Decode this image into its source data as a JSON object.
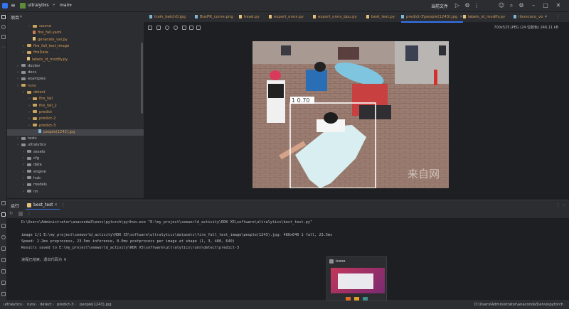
{
  "titlebar": {
    "project": "ultralytics",
    "branch": "main",
    "current_file": "当前文件",
    "menu_icon": "hamburger-icon"
  },
  "project_panel": {
    "title": "项目",
    "items": [
      {
        "label": "source",
        "type": "folder",
        "depth": 3,
        "color": "orange"
      },
      {
        "label": "fire_fall.yaml",
        "type": "yaml",
        "depth": 3
      },
      {
        "label": "generate_val.py",
        "type": "py",
        "depth": 3
      },
      {
        "label": "fire_fall_test_image",
        "type": "folder",
        "depth": 2,
        "color": "orange"
      },
      {
        "label": "fireData",
        "type": "folder",
        "depth": 2,
        "color": "orange"
      },
      {
        "label": "labels_id_modify.py",
        "type": "py",
        "depth": 2
      },
      {
        "label": "docker",
        "type": "folder",
        "depth": 1
      },
      {
        "label": "docs",
        "type": "folder",
        "depth": 1
      },
      {
        "label": "examples",
        "type": "folder",
        "depth": 1
      },
      {
        "label": "runs",
        "type": "folder",
        "depth": 1,
        "color": "orange"
      },
      {
        "label": "detect",
        "type": "folder",
        "depth": 2,
        "color": "orange"
      },
      {
        "label": "fire_fall",
        "type": "folder",
        "depth": 3,
        "color": "orange"
      },
      {
        "label": "fire_fall_2",
        "type": "folder",
        "depth": 3,
        "color": "orange"
      },
      {
        "label": "predict",
        "type": "folder",
        "depth": 3,
        "color": "orange"
      },
      {
        "label": "predict-2",
        "type": "folder",
        "depth": 3,
        "color": "orange"
      },
      {
        "label": "predict-3",
        "type": "folder",
        "depth": 3,
        "color": "orange"
      },
      {
        "label": "people(1243).jpg",
        "type": "img",
        "depth": 4,
        "selected": true
      },
      {
        "label": "tests",
        "type": "folder",
        "depth": 1
      },
      {
        "label": "ultralytics",
        "type": "folder",
        "depth": 1
      },
      {
        "label": "assets",
        "type": "folder",
        "depth": 2
      },
      {
        "label": "cfg",
        "type": "folder",
        "depth": 2
      },
      {
        "label": "data",
        "type": "folder",
        "depth": 2
      },
      {
        "label": "engine",
        "type": "folder",
        "depth": 2
      },
      {
        "label": "hub",
        "type": "folder",
        "depth": 2
      },
      {
        "label": "models",
        "type": "folder",
        "depth": 2
      },
      {
        "label": "nn",
        "type": "folder",
        "depth": 2
      }
    ]
  },
  "tabs": [
    {
      "label": "train_batch0.jpg"
    },
    {
      "label": "BoxPR_curve.png"
    },
    {
      "label": "head.py"
    },
    {
      "label": "export_onnx.py"
    },
    {
      "label": "export_onnx_bpu.py"
    },
    {
      "label": "best_test.py"
    },
    {
      "label": "predict-3\\people(1243).jpg",
      "active": true
    },
    {
      "label": "labels_id_modify.py"
    },
    {
      "label": "ilovecoco_vo"
    }
  ],
  "image_info": "700x525 JPEG (24 位颜色) 246.11 kB",
  "image": {
    "detection_label": "1 0.70",
    "watermark": "来自网"
  },
  "run_panel": {
    "title": "运行",
    "tab_label": "best_test",
    "lines": [
      "D:\\Users\\Administrator\\anaconda3\\envs\\pytorch\\python.exe \"E:\\my_project\\seeworld_activity\\RDK X5\\software\\ultralytics\\best_test.py\"",
      "",
      "image 1/1 E:\\my_project\\seeworld_activity\\RDK X5\\software\\ultralytics\\datasets\\fire_fall_test_image\\people(1243).jpg: 480x640 1 fall, 23.5ms",
      "Speed: 2.2ms preprocess, 23.5ms inference, 0.0ms postprocess per image at shape (1, 3, 480, 640)",
      "Results saved to E:\\my_project\\seeworld_activity\\RDK X5\\software\\ultralytics\\runs\\detect\\predict-3",
      "",
      "进程已结束，退出代码为 0"
    ]
  },
  "popup": {
    "title": "icone"
  },
  "status": {
    "crumbs": [
      "ultralytics",
      "runs",
      "detect",
      "predict-3",
      "people(1243).jpg"
    ],
    "right_text": "D:\\Users\\Administrator\\anaconda3\\envs\\pytorch"
  }
}
